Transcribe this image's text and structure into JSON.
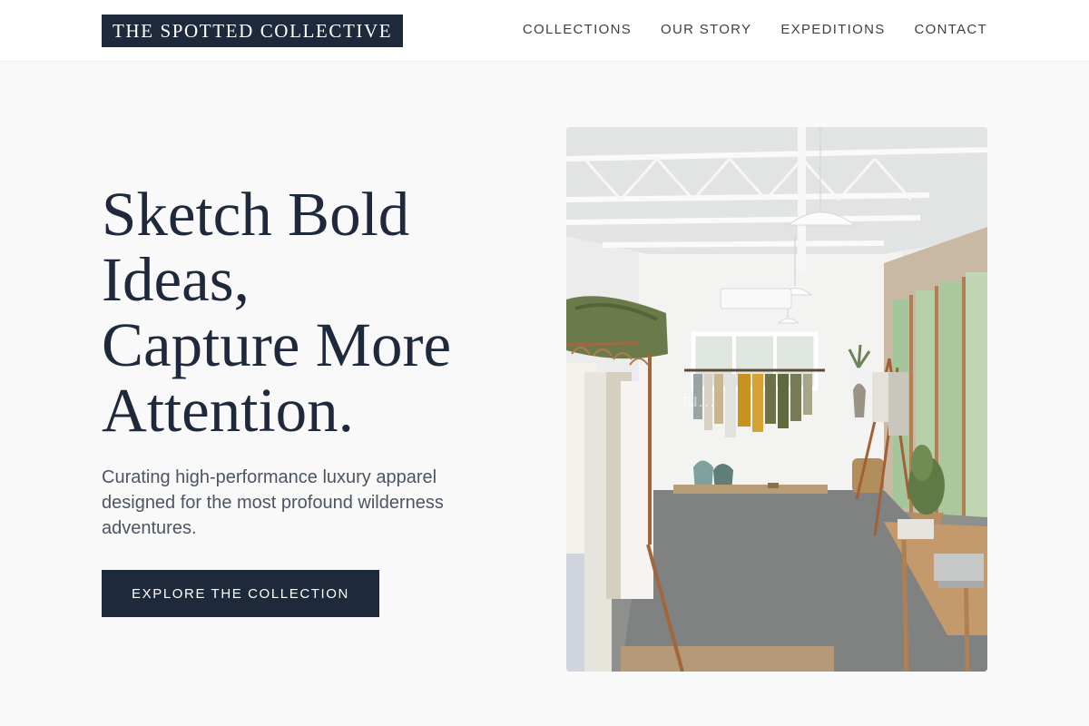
{
  "brand": {
    "name": "THE SPOTTED COLLECTIVE"
  },
  "nav": {
    "items": [
      {
        "label": "COLLECTIONS"
      },
      {
        "label": "OUR STORY"
      },
      {
        "label": "EXPEDITIONS"
      },
      {
        "label": "CONTACT"
      }
    ]
  },
  "hero": {
    "title_lines": [
      "Sketch Bold",
      "Ideas,",
      "Capture More",
      "Attention."
    ],
    "subtitle": "Curating high-performance luxury apparel designed for the most profound wilderness adventures.",
    "cta_label": "EXPLORE THE COLLECTION",
    "image_watermark": "fu…"
  },
  "colors": {
    "brand_navy": "#1e293b",
    "page_background": "#f9f9f9",
    "header_background": "#ffffff",
    "nav_text": "#3f3f46",
    "body_text": "#4b5563"
  }
}
